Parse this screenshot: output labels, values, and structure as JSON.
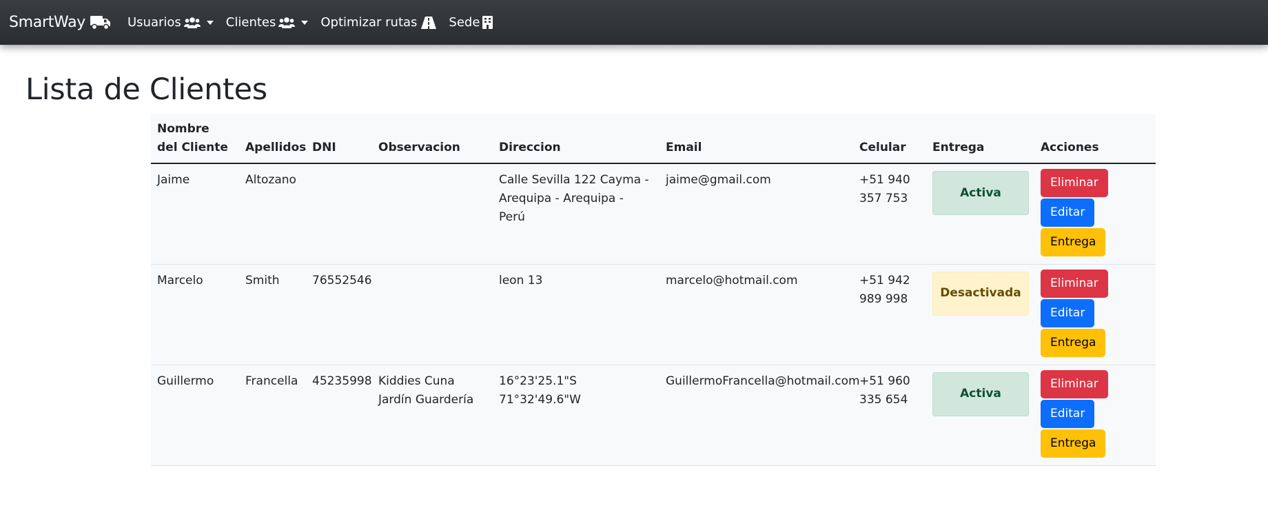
{
  "navbar": {
    "brand": "SmartWay",
    "items": [
      {
        "label": "Usuarios"
      },
      {
        "label": "Clientes"
      },
      {
        "label": "Optimizar rutas"
      },
      {
        "label": "Sede"
      }
    ]
  },
  "page": {
    "title": "Lista de Clientes"
  },
  "table": {
    "headers": [
      "Nombre del Cliente",
      "Apellidos",
      "DNI",
      "Observacion",
      "Direccion",
      "Email",
      "Celular",
      "Entrega",
      "Acciones"
    ],
    "rows": [
      {
        "nombre": "Jaime",
        "apellidos": "Altozano",
        "dni": "",
        "observacion": "",
        "direccion": "Calle Sevilla 122 Cayma - Arequipa - Arequipa - Perú",
        "email": "jaime@gmail.com",
        "celular": "+51 940 357 753",
        "entrega": "Activa",
        "entrega_state": "activa"
      },
      {
        "nombre": "Marcelo",
        "apellidos": "Smith",
        "dni": "76552546",
        "observacion": "",
        "direccion": "leon 13",
        "email": "marcelo@hotmail.com",
        "celular": "+51 942 989 998",
        "entrega": "Desactivada",
        "entrega_state": "desactivada"
      },
      {
        "nombre": "Guillermo",
        "apellidos": "Francella",
        "dni": "45235998",
        "observacion": "Kiddies Cuna Jardín Guardería",
        "direccion": "16°23'25.1\"S 71°32'49.6\"W",
        "email": "GuillermoFrancella@hotmail.com",
        "celular": "+51 960 335 654",
        "entrega": "Activa",
        "entrega_state": "activa"
      }
    ],
    "actions": {
      "delete": "Eliminar",
      "edit": "Editar",
      "deliver": "Entrega"
    }
  },
  "colors": {
    "navbar_bg": "#343a40",
    "danger": "#dc3545",
    "primary": "#0d6efd",
    "warning": "#ffc107",
    "success_bg": "#d1e7dd",
    "warning_bg": "#fff3cd"
  },
  "icons": {
    "brand": "truck-icon",
    "usuarios": "users-icon",
    "clientes": "users-icon",
    "optimizar": "road-icon",
    "sede": "building-icon"
  }
}
